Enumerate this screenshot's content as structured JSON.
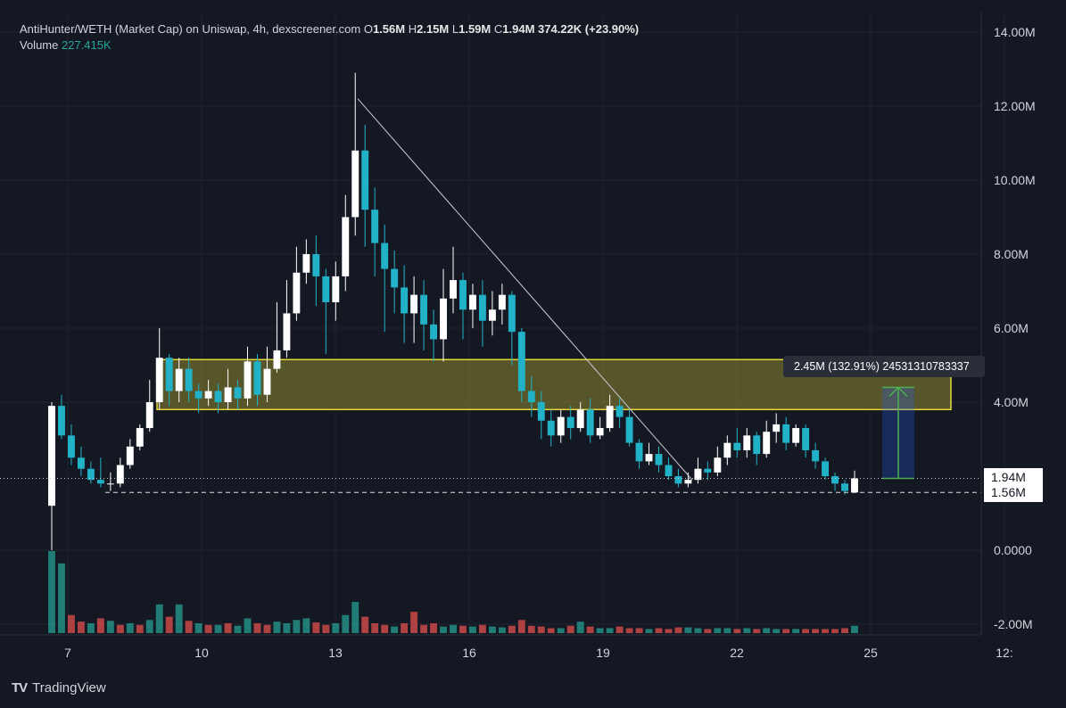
{
  "legend": {
    "symbol": "AntiHunter/WETH (Market Cap) on Uniswap, 4h, dexscreener.com",
    "o_label": "O",
    "o_value": "1.56M",
    "h_label": "H",
    "h_value": "2.15M",
    "l_label": "L",
    "l_value": "1.59M",
    "c_label": "C",
    "c_value": "1.94M",
    "change": "374.22K (+23.90%)",
    "volume_label": "Volume",
    "volume_value": "227.415K"
  },
  "price_tags": {
    "last": "1.94M",
    "open": "1.56M"
  },
  "measure": {
    "label": "2.45M (132.91%) 24531310783337"
  },
  "brand": {
    "name": "TradingView"
  },
  "colors": {
    "up": "#ffffff",
    "down": "#22b2c8",
    "vol_up": "#26a69a",
    "vol_down": "#ef5350",
    "zone": "#e6d83a",
    "measure": "#4caf50",
    "background": "#141823"
  },
  "chart_data": {
    "type": "candlestick",
    "title": "AntiHunter/WETH (Market Cap) on Uniswap, 4h, dexscreener.com",
    "y_axis": {
      "ticks": [
        "14.00M",
        "12.00M",
        "10.00M",
        "8.00M",
        "6.00M",
        "4.00M",
        "0.0000",
        "-2.00M"
      ],
      "tick_values": [
        14,
        12,
        10,
        8,
        6,
        4,
        0,
        -2
      ],
      "unit": "M",
      "range": [
        -2.2,
        14.8
      ]
    },
    "x_axis": {
      "ticks": [
        "7",
        "10",
        "13",
        "16",
        "19",
        "22",
        "25",
        "12:"
      ],
      "tick_days": [
        7,
        10,
        13,
        16,
        19,
        22,
        25,
        28
      ]
    },
    "candles": [
      [
        1.2,
        3.9,
        4.0,
        0.0
      ],
      [
        3.9,
        3.1,
        4.2,
        3.0
      ],
      [
        3.1,
        2.5,
        3.4,
        2.3
      ],
      [
        2.5,
        2.2,
        2.8,
        2.0
      ],
      [
        2.2,
        1.9,
        2.4,
        1.8
      ],
      [
        1.9,
        1.8,
        2.5,
        1.7
      ],
      [
        1.8,
        1.8,
        2.1,
        1.6
      ],
      [
        1.8,
        2.3,
        2.5,
        1.7
      ],
      [
        2.3,
        2.8,
        3.0,
        2.2
      ],
      [
        2.8,
        3.3,
        3.4,
        2.7
      ],
      [
        3.3,
        4.0,
        4.6,
        3.2
      ],
      [
        4.0,
        5.2,
        6.0,
        3.8
      ],
      [
        5.2,
        4.3,
        5.3,
        3.9
      ],
      [
        4.3,
        4.9,
        5.2,
        4.0
      ],
      [
        4.9,
        4.3,
        5.2,
        4.0
      ],
      [
        4.3,
        4.1,
        4.5,
        3.7
      ],
      [
        4.1,
        4.3,
        4.6,
        3.9
      ],
      [
        4.3,
        4.0,
        4.5,
        3.7
      ],
      [
        4.0,
        4.4,
        4.9,
        3.8
      ],
      [
        4.4,
        4.1,
        4.6,
        3.8
      ],
      [
        4.1,
        5.1,
        5.5,
        3.9
      ],
      [
        5.1,
        4.2,
        5.3,
        3.9
      ],
      [
        4.2,
        4.9,
        5.5,
        4.0
      ],
      [
        4.9,
        5.4,
        6.7,
        4.8
      ],
      [
        5.4,
        6.4,
        7.3,
        5.2
      ],
      [
        6.4,
        7.5,
        8.2,
        6.2
      ],
      [
        7.5,
        8.0,
        8.4,
        7.2
      ],
      [
        8.0,
        7.4,
        8.5,
        6.6
      ],
      [
        7.4,
        6.7,
        7.6,
        5.3
      ],
      [
        6.7,
        7.4,
        7.8,
        6.2
      ],
      [
        7.4,
        9.0,
        9.6,
        7.0
      ],
      [
        9.0,
        10.8,
        12.9,
        8.5
      ],
      [
        10.8,
        9.2,
        11.5,
        8.2
      ],
      [
        9.2,
        8.3,
        9.8,
        7.4
      ],
      [
        8.3,
        7.6,
        8.8,
        5.9
      ],
      [
        7.6,
        7.1,
        8.1,
        6.4
      ],
      [
        7.1,
        6.4,
        7.7,
        5.6
      ],
      [
        6.4,
        6.9,
        7.4,
        5.6
      ],
      [
        6.9,
        6.1,
        7.3,
        5.4
      ],
      [
        6.1,
        5.7,
        6.5,
        5.1
      ],
      [
        5.7,
        6.8,
        7.6,
        5.1
      ],
      [
        6.8,
        7.3,
        8.2,
        6.4
      ],
      [
        7.3,
        6.5,
        7.5,
        5.7
      ],
      [
        6.5,
        6.9,
        7.2,
        6.0
      ],
      [
        6.9,
        6.2,
        7.3,
        5.5
      ],
      [
        6.2,
        6.5,
        7.0,
        5.8
      ],
      [
        6.5,
        6.9,
        7.2,
        6.1
      ],
      [
        6.9,
        5.9,
        7.0,
        5.0
      ],
      [
        5.9,
        4.3,
        6.0,
        4.0
      ],
      [
        4.3,
        4.0,
        4.7,
        3.6
      ],
      [
        4.0,
        3.5,
        4.3,
        3.0
      ],
      [
        3.5,
        3.1,
        3.8,
        2.8
      ],
      [
        3.1,
        3.6,
        3.8,
        2.9
      ],
      [
        3.6,
        3.3,
        3.9,
        3.0
      ],
      [
        3.3,
        3.8,
        4.0,
        3.2
      ],
      [
        3.8,
        3.1,
        4.1,
        2.9
      ],
      [
        3.1,
        3.3,
        3.6,
        3.0
      ],
      [
        3.3,
        3.9,
        4.2,
        3.2
      ],
      [
        3.9,
        3.6,
        4.1,
        3.3
      ],
      [
        3.6,
        2.9,
        3.8,
        2.8
      ],
      [
        2.9,
        2.4,
        3.0,
        2.2
      ],
      [
        2.4,
        2.6,
        2.9,
        2.3
      ],
      [
        2.6,
        2.3,
        2.8,
        2.1
      ],
      [
        2.3,
        2.0,
        2.5,
        1.9
      ],
      [
        2.0,
        1.8,
        2.2,
        1.7
      ],
      [
        1.8,
        1.9,
        2.1,
        1.7
      ],
      [
        1.9,
        2.2,
        2.5,
        1.8
      ],
      [
        2.2,
        2.1,
        2.4,
        1.9
      ],
      [
        2.1,
        2.5,
        2.8,
        2.0
      ],
      [
        2.5,
        2.9,
        3.1,
        2.3
      ],
      [
        2.9,
        2.7,
        3.3,
        2.5
      ],
      [
        2.7,
        3.1,
        3.3,
        2.5
      ],
      [
        3.1,
        2.6,
        3.2,
        2.3
      ],
      [
        2.6,
        3.2,
        3.5,
        2.5
      ],
      [
        3.2,
        3.4,
        3.7,
        2.9
      ],
      [
        3.4,
        2.9,
        3.6,
        2.7
      ],
      [
        2.9,
        3.3,
        3.4,
        2.8
      ],
      [
        3.3,
        2.7,
        3.4,
        2.5
      ],
      [
        2.7,
        2.4,
        2.9,
        2.2
      ],
      [
        2.4,
        2.0,
        2.5,
        1.9
      ],
      [
        2.0,
        1.8,
        2.1,
        1.6
      ],
      [
        1.8,
        1.6,
        1.9,
        1.5
      ],
      [
        1.56,
        1.94,
        2.15,
        1.59
      ]
    ],
    "volumes": [
      [
        1.0,
        1
      ],
      [
        0.85,
        1
      ],
      [
        0.22,
        0
      ],
      [
        0.14,
        0
      ],
      [
        0.12,
        1
      ],
      [
        0.18,
        0
      ],
      [
        0.15,
        1
      ],
      [
        0.1,
        0
      ],
      [
        0.12,
        1
      ],
      [
        0.1,
        0
      ],
      [
        0.16,
        1
      ],
      [
        0.35,
        1
      ],
      [
        0.2,
        0
      ],
      [
        0.35,
        1
      ],
      [
        0.15,
        0
      ],
      [
        0.12,
        1
      ],
      [
        0.1,
        0
      ],
      [
        0.1,
        1
      ],
      [
        0.12,
        0
      ],
      [
        0.09,
        1
      ],
      [
        0.18,
        1
      ],
      [
        0.12,
        0
      ],
      [
        0.1,
        0
      ],
      [
        0.14,
        1
      ],
      [
        0.12,
        1
      ],
      [
        0.16,
        1
      ],
      [
        0.18,
        1
      ],
      [
        0.13,
        0
      ],
      [
        0.1,
        0
      ],
      [
        0.12,
        1
      ],
      [
        0.22,
        1
      ],
      [
        0.38,
        1
      ],
      [
        0.2,
        0
      ],
      [
        0.12,
        0
      ],
      [
        0.1,
        0
      ],
      [
        0.08,
        1
      ],
      [
        0.12,
        0
      ],
      [
        0.26,
        0
      ],
      [
        0.1,
        0
      ],
      [
        0.12,
        0
      ],
      [
        0.08,
        1
      ],
      [
        0.1,
        1
      ],
      [
        0.09,
        0
      ],
      [
        0.08,
        1
      ],
      [
        0.1,
        0
      ],
      [
        0.08,
        1
      ],
      [
        0.07,
        1
      ],
      [
        0.09,
        0
      ],
      [
        0.16,
        0
      ],
      [
        0.09,
        0
      ],
      [
        0.08,
        0
      ],
      [
        0.06,
        0
      ],
      [
        0.06,
        1
      ],
      [
        0.09,
        0
      ],
      [
        0.14,
        1
      ],
      [
        0.08,
        0
      ],
      [
        0.06,
        1
      ],
      [
        0.06,
        1
      ],
      [
        0.08,
        0
      ],
      [
        0.06,
        0
      ],
      [
        0.06,
        0
      ],
      [
        0.05,
        1
      ],
      [
        0.06,
        0
      ],
      [
        0.05,
        0
      ],
      [
        0.07,
        0
      ],
      [
        0.07,
        1
      ],
      [
        0.06,
        1
      ],
      [
        0.05,
        0
      ],
      [
        0.06,
        1
      ],
      [
        0.06,
        1
      ],
      [
        0.05,
        0
      ],
      [
        0.06,
        1
      ],
      [
        0.05,
        0
      ],
      [
        0.06,
        1
      ],
      [
        0.05,
        1
      ],
      [
        0.05,
        0
      ],
      [
        0.05,
        1
      ],
      [
        0.05,
        0
      ],
      [
        0.05,
        0
      ],
      [
        0.05,
        0
      ],
      [
        0.05,
        0
      ],
      [
        0.06,
        0
      ],
      [
        0.09,
        1
      ]
    ],
    "zone": {
      "top": 5.15,
      "bottom": 3.8
    },
    "trendline": {
      "from": [
        13.5,
        12.2
      ],
      "to": [
        21.0,
        1.9
      ]
    },
    "measure": {
      "from": 1.94,
      "to": 4.4,
      "label": "2.45M (132.91%)"
    },
    "price_lines": {
      "last": 1.94,
      "open": 1.56
    }
  }
}
